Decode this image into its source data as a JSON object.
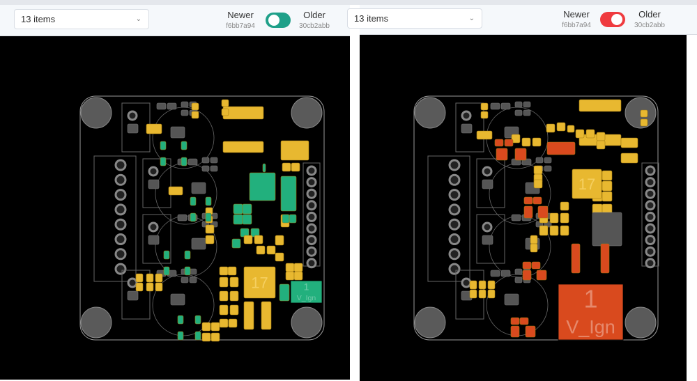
{
  "panels": [
    {
      "items_select": "13 items",
      "newer_label": "Newer",
      "newer_hash": "f6bb7a94",
      "older_label": "Older",
      "older_hash": "30cb2abb",
      "toggle_color": "#1fa089",
      "highlight_color": "#22b07d",
      "ic_label": "17",
      "conn_label": "1",
      "conn_name": "V_Ign"
    },
    {
      "items_select": "13 items",
      "newer_label": "Newer",
      "newer_hash": "f6bb7a94",
      "older_label": "Older",
      "older_hash": "30cb2abb",
      "toggle_color": "#ef3b3f",
      "highlight_color": "#d94a1e",
      "ic_label": "17",
      "conn_label": "1",
      "conn_name": "V_Ign"
    }
  ],
  "colors": {
    "pad_common": "#e8b830",
    "pad_unchanged": "#555555",
    "board_outline": "#9a9a9a"
  }
}
